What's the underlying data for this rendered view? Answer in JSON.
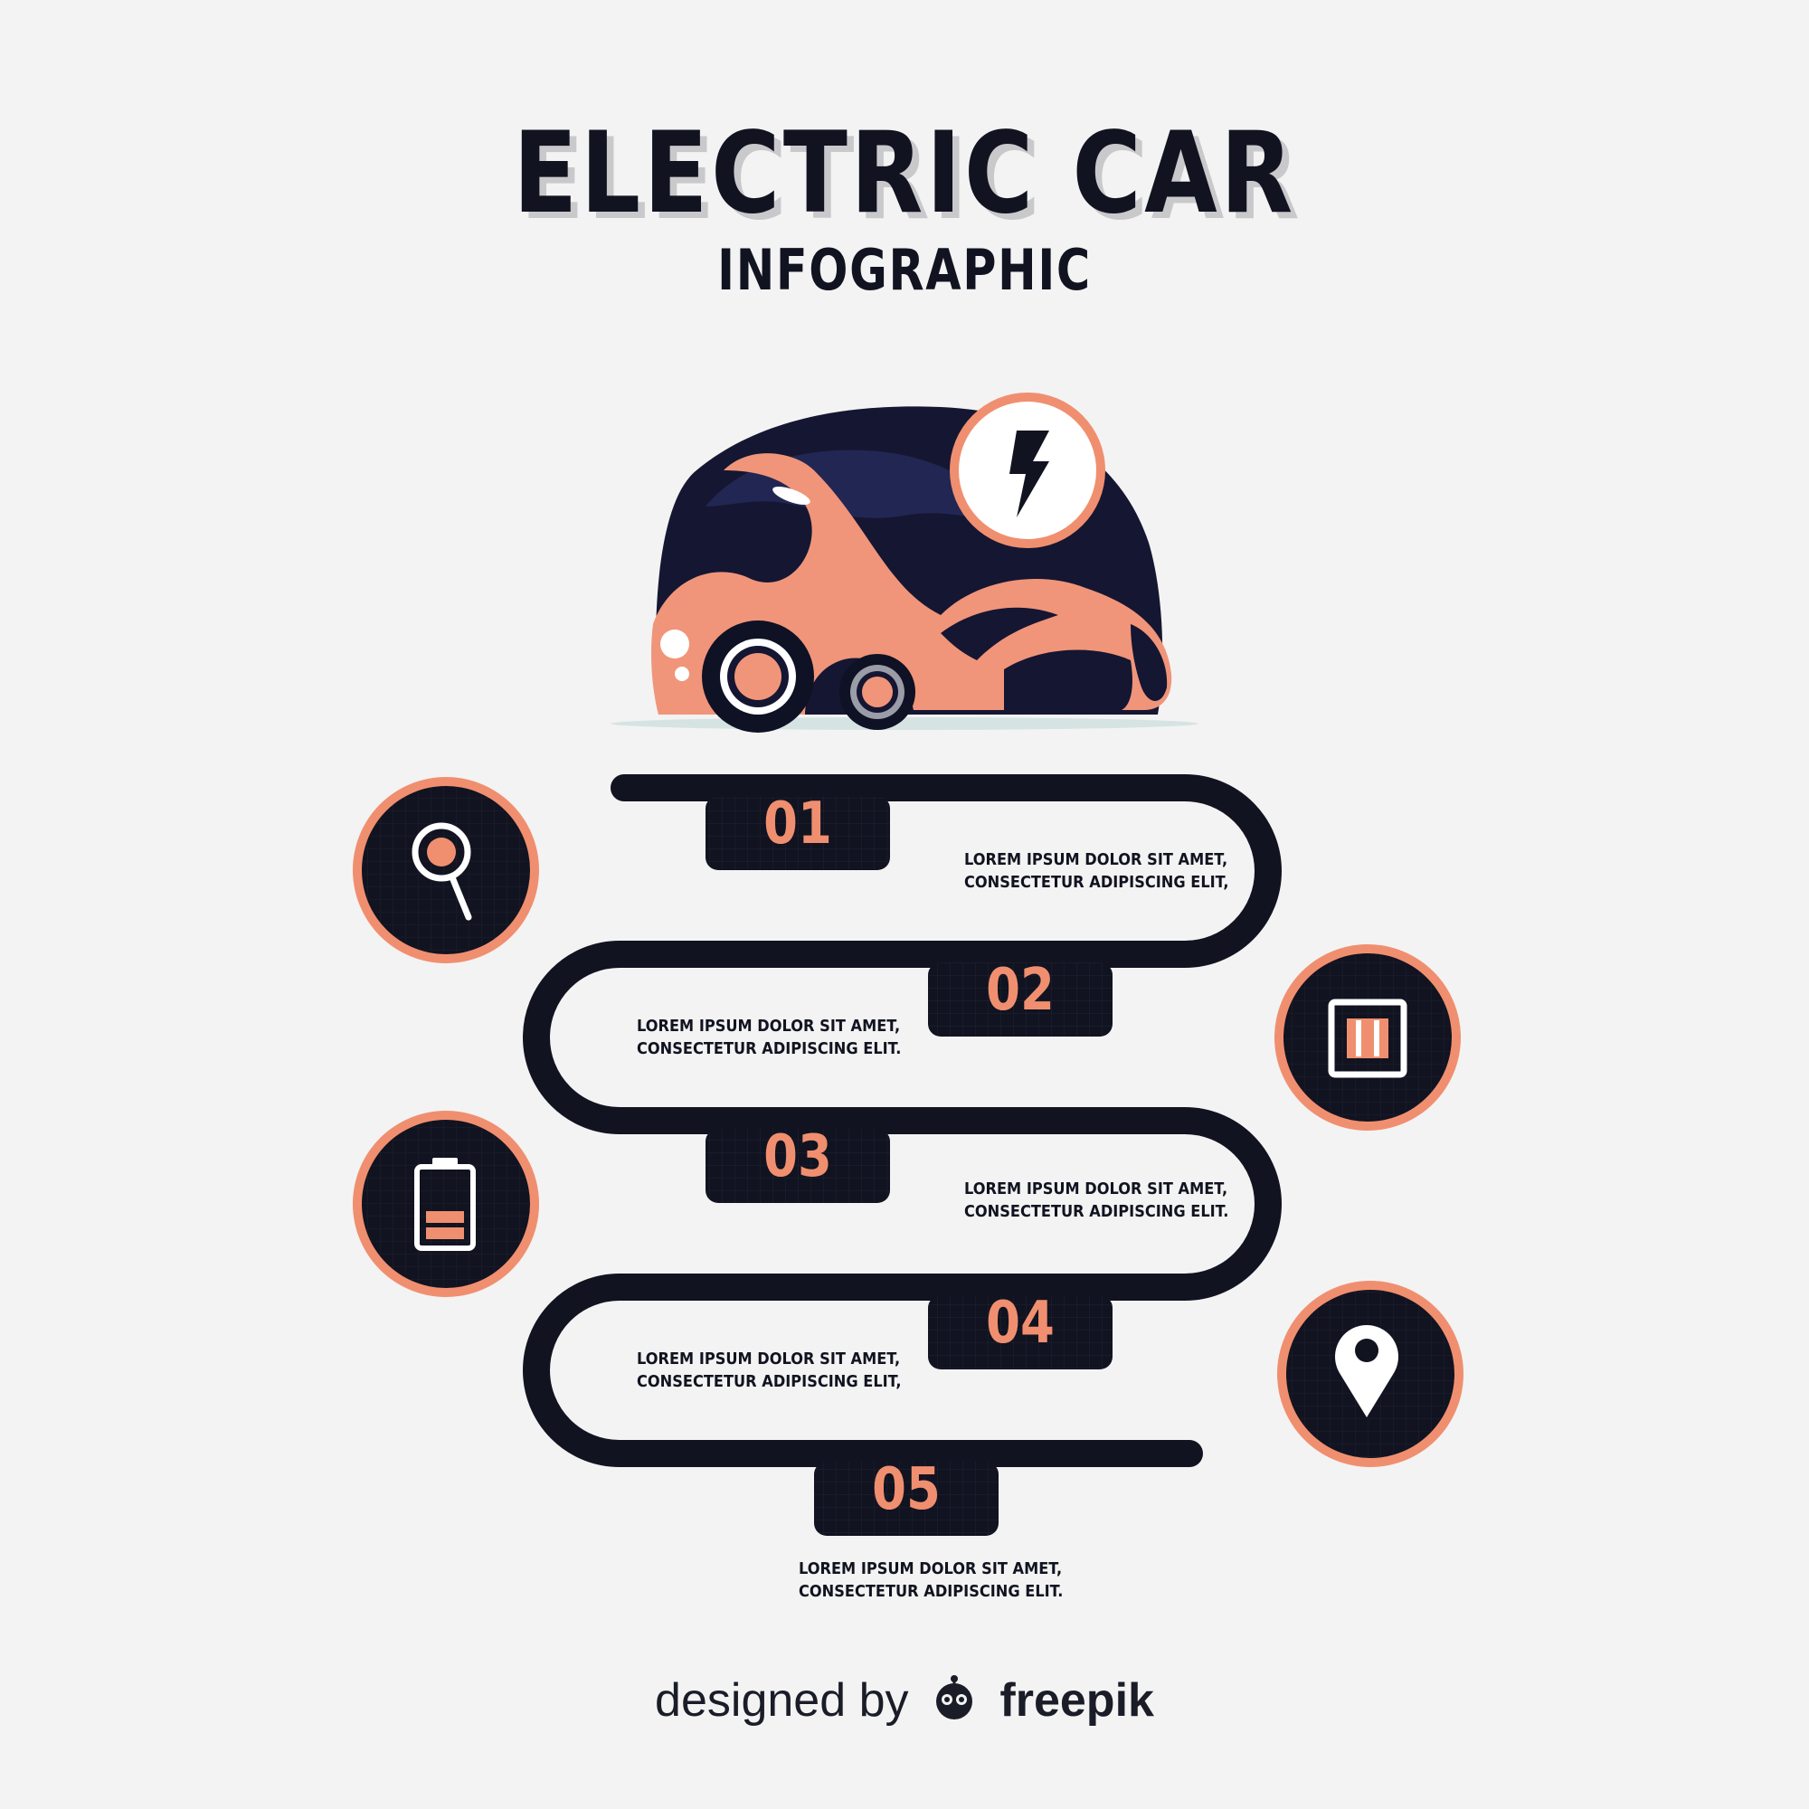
{
  "title": "ELECTRIC CAR",
  "subtitle": "INFOGRAPHIC",
  "steps": [
    {
      "number": "01",
      "line1": "LOREM IPSUM DOLOR SIT AMET,",
      "line2": "CONSECTETUR ADIPISCING ELIT,",
      "icon": "magnifier-icon"
    },
    {
      "number": "02",
      "line1": "LOREM IPSUM DOLOR SIT AMET,",
      "line2": "CONSECTETUR ADIPISCING ELIT.",
      "icon": "socket-icon"
    },
    {
      "number": "03",
      "line1": "LOREM IPSUM DOLOR SIT AMET,",
      "line2": "CONSECTETUR ADIPISCING ELIT.",
      "icon": "battery-icon"
    },
    {
      "number": "04",
      "line1": "LOREM IPSUM DOLOR SIT AMET,",
      "line2": "CONSECTETUR ADIPISCING ELIT,",
      "icon": "map-pin-icon"
    },
    {
      "number": "05",
      "line1": "LOREM IPSUM DOLOR SIT AMET,",
      "line2": "CONSECTETUR ADIPISCING ELIT.",
      "icon": null
    }
  ],
  "credit": {
    "prefix": "designed by",
    "brand": "freepik"
  },
  "colors": {
    "dark": "#111320",
    "accent": "#f08f6f",
    "background": "#f3f3f3"
  }
}
